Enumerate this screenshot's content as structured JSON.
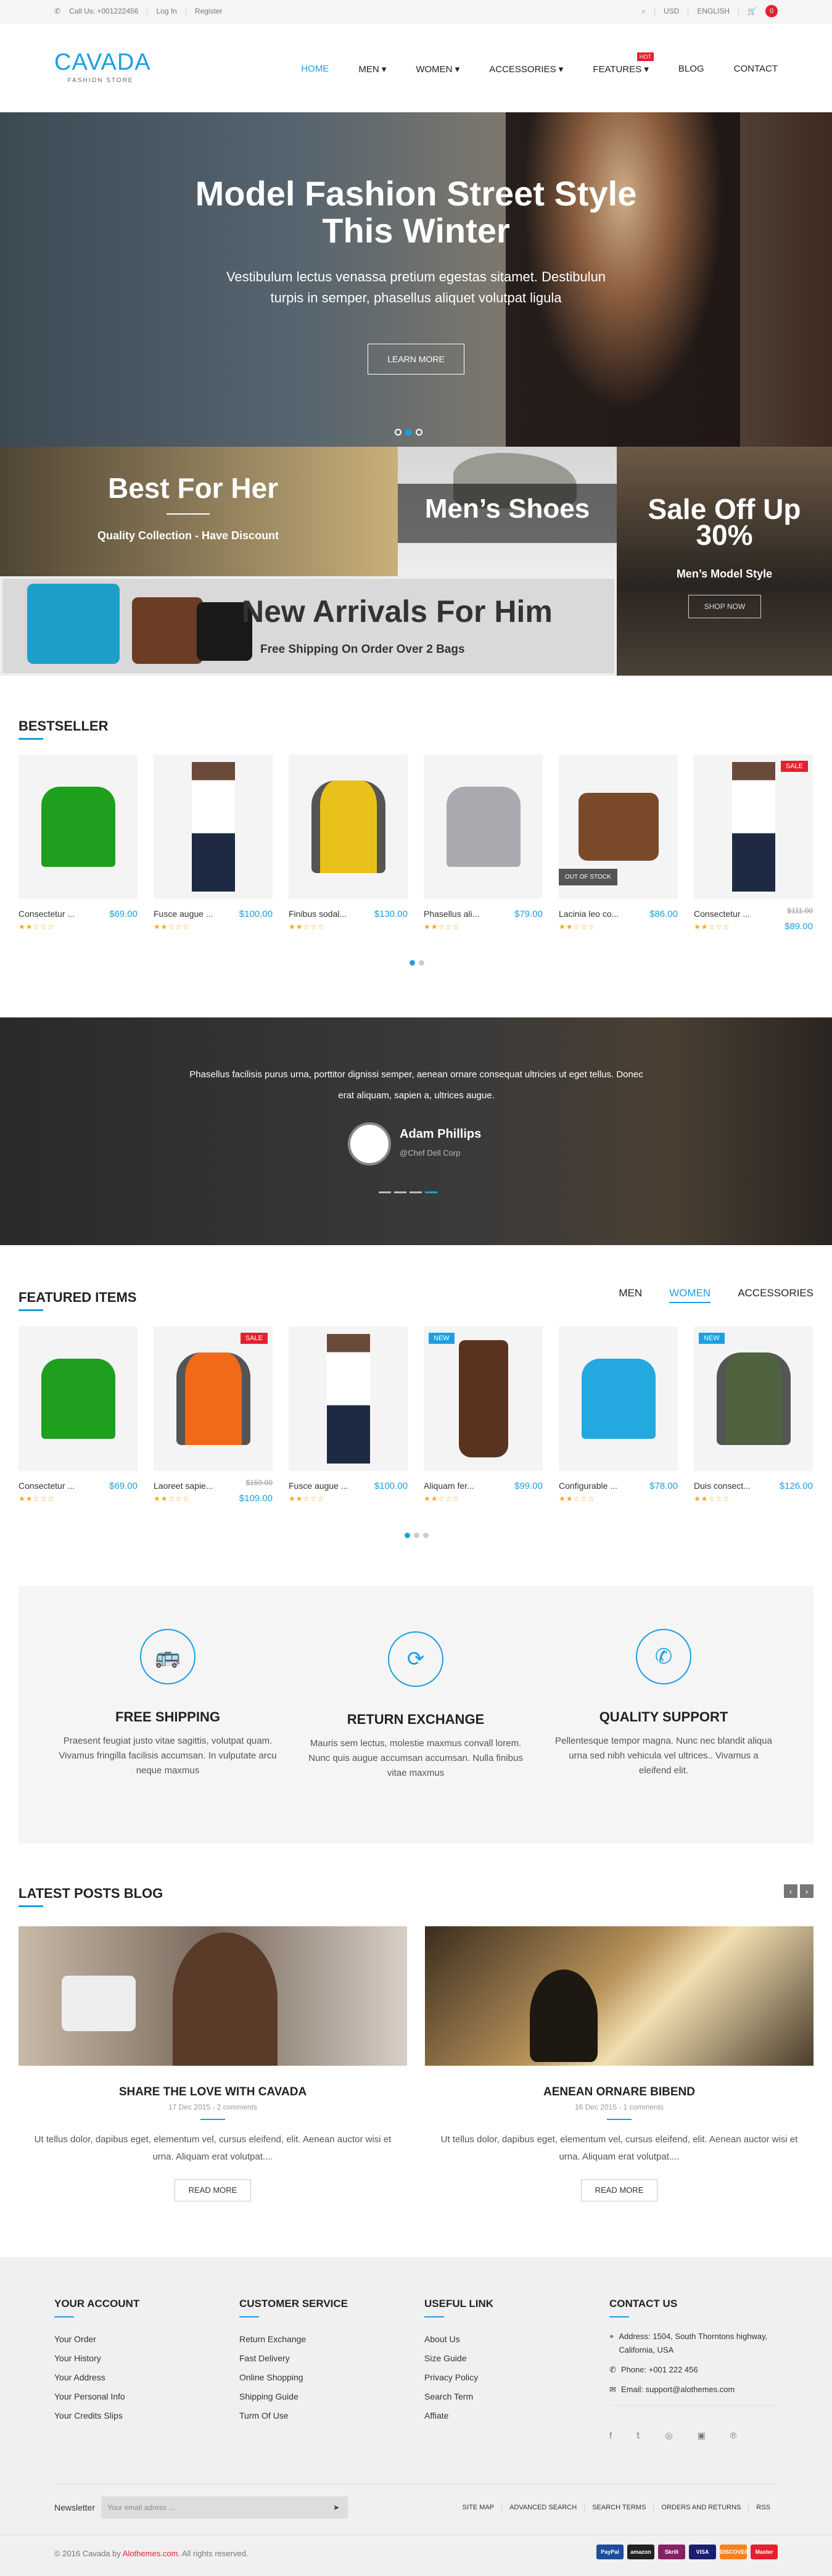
{
  "topbar": {
    "phone": "Call Us: +001222456",
    "login": "Log In",
    "register": "Register",
    "currency": "USD",
    "language": "ENGLISH",
    "cart_count": "0"
  },
  "logo": {
    "name": "CAVADA",
    "sub": "FASHION STORE"
  },
  "nav": {
    "items": [
      "HOME",
      "MEN",
      "WOMEN",
      "ACCESSORIES",
      "FEATURES",
      "BLOG",
      "CONTACT"
    ],
    "hot": "HOT"
  },
  "hero": {
    "title_line1": "Model Fashion Street Style",
    "title_line2": "This Winter",
    "desc_line1": "Vestibulum lectus venassa pretium egestas sitamet. Destibulun",
    "desc_line2": "turpis in semper, phasellus aliquet volutpat ligula",
    "button": "LEARN MORE"
  },
  "banners": {
    "her": {
      "title": "Best For Her",
      "sub": "Quality Collection - Have Discount"
    },
    "shoes": {
      "title": "Men’s Shoes"
    },
    "sale": {
      "title_line1": "Sale Off Up",
      "title_line2": "30%",
      "sub": "Men’s Model Style",
      "button": "SHOP NOW"
    },
    "arrivals": {
      "title": "New Arrivals For Him",
      "sub": "Free Shipping On Order Over 2 Bags"
    }
  },
  "bestseller": {
    "title": "BESTSELLER",
    "products": [
      {
        "name": "Consectetur ...",
        "price": "$69.00"
      },
      {
        "name": "Fusce augue ...",
        "price": "$100.00"
      },
      {
        "name": "Finibus sodal...",
        "price": "$130.00"
      },
      {
        "name": "Phasellus ali...",
        "price": "$79.00"
      },
      {
        "name": "Lacinia leo co...",
        "price": "$86.00",
        "badge": "OUT OF STOCK"
      },
      {
        "name": "Consectetur ...",
        "old_price": "$111.00",
        "price": "$89.00",
        "badge": "SALE"
      }
    ]
  },
  "testimonial": {
    "quote_line1": "Phasellus facilisis purus urna, porttitor dignissi semper, aenean ornare consequat ultricies ut eget tellus. Donec",
    "quote_line2": "erat aliquam, sapien a, ultrices augue.",
    "name": "Adam Phillips",
    "role": "@Chef Dell Corp"
  },
  "featured": {
    "title": "FEATURED ITEMS",
    "tabs": [
      "MEN",
      "WOMEN",
      "ACCESSORIES"
    ],
    "products": [
      {
        "name": "Consectetur ...",
        "price": "$69.00"
      },
      {
        "name": "Laoreet sapie...",
        "old_price": "$159.00",
        "price": "$109.00",
        "badge": "SALE"
      },
      {
        "name": "Fusce augue ...",
        "price": "$100.00"
      },
      {
        "name": "Aliquam fer...",
        "price": "$99.00",
        "badge": "NEW"
      },
      {
        "name": "Configurable ...",
        "price": "$78.00"
      },
      {
        "name": "Duis consect...",
        "price": "$126.00",
        "badge": "NEW"
      }
    ]
  },
  "services": [
    {
      "title": "FREE SHIPPING",
      "desc": "Praesent feugiat justo vitae sagittis, volutpat quam. Vivamus fringilla facilisis accumsan. In vulputate arcu neque maxmus"
    },
    {
      "title": "RETURN EXCHANGE",
      "desc": "Mauris sem lectus, molestie maxmus convall lorem. Nunc quis augue accumsan accumsan. Nulla finibus vitae maxmus"
    },
    {
      "title": "QUALITY SUPPORT",
      "desc": "Pellentesque tempor magna. Nunc nec blandit aliqua urna sed nibh vehicula vel ultrices.. Vivamus a eleifend elit."
    }
  ],
  "blog": {
    "title": "LATEST POSTS BLOG",
    "posts": [
      {
        "title": "SHARE THE LOVE WITH CAVADA",
        "date": "17 Dec 2015 - 2 comments",
        "desc": "Ut tellus dolor, dapibus eget, elementum vel, cursus eleifend, elit. Aenean auctor wisi et urna. Aliquam erat volutpat....",
        "button": "READ MORE"
      },
      {
        "title": "AENEAN ORNARE BIBEND",
        "date": "16 Dec 2015 - 1 comments",
        "desc": "Ut tellus dolor, dapibus eget, elementum vel, cursus eleifend, elit. Aenean auctor wisi et urna. Aliquam erat volutpat....",
        "button": "READ MORE"
      }
    ]
  },
  "footer": {
    "account": {
      "title": "YOUR ACCOUNT",
      "items": [
        "Your Order",
        "Your History",
        "Your Address",
        "Your Personal Info",
        "Your Credits Slips"
      ]
    },
    "service": {
      "title": "CUSTOMER SERVICE",
      "items": [
        "Return Exchange",
        "Fast Delivery",
        "Online Shopping",
        "Shipping Guide",
        "Turm Of Use"
      ]
    },
    "useful": {
      "title": "USEFUL LINK",
      "items": [
        "About Us",
        "Size Guide",
        "Privacy Policy",
        "Search Term",
        "Affiate"
      ]
    },
    "contact": {
      "title": "CONTACT US",
      "address_label": "Address:",
      "address": "1504, South Thorntons highway, California, USA",
      "phone_label": "Phone:",
      "phone": "+001 222 456",
      "email_label": "Email:",
      "email": "support@alothemes.com"
    },
    "newsletter": {
      "label": "Newsletter",
      "placeholder": "Your email adress ..."
    },
    "links": [
      "SITE MAP",
      "ADVANCED SEARCH",
      "SEARCH TERMS",
      "ORDERS AND RETURNS",
      "RSS"
    ],
    "copyright_pre": "© 2016 Cavada by ",
    "copyright_brand": "Alothemes.com",
    "copyright_post": ". All rights reserved.",
    "payments": [
      "PayPal",
      "amazon",
      "Skrill",
      "VISA",
      "DISCOVER",
      "Master"
    ]
  },
  "colors": {
    "accent": "#1c9fe0",
    "sale": "#e5202e"
  }
}
